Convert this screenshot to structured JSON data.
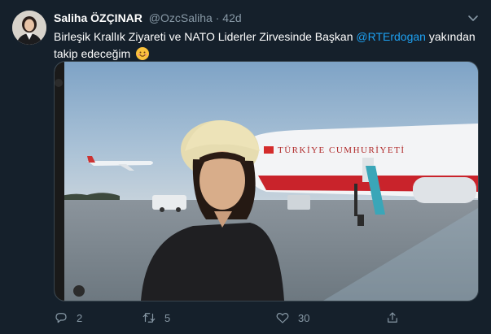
{
  "tweet": {
    "display_name": "Saliha ÖZÇINAR",
    "handle": "@OzcSaliha",
    "separator": "·",
    "time": "42d",
    "text_before": "Birleşik Krallık Ziyareti ve NATO Liderler Zirvesinde Başkan ",
    "mention": "@RTErdogan",
    "text_after": " yakından takip edeceğim",
    "emoji": "smiling-face-emoji",
    "plane_livery": "TÜRKİYE CUMHURİYETİ"
  },
  "actions": {
    "reply_count": "2",
    "retweet_count": "5",
    "like_count": "30"
  },
  "icons": [
    "chevron-down-icon",
    "reply-icon",
    "retweet-icon",
    "like-icon",
    "share-icon"
  ],
  "colors": {
    "background": "#15202b",
    "text_primary": "#ffffff",
    "text_secondary": "#8899a6",
    "link": "#1da1f2",
    "border": "#38444d"
  }
}
